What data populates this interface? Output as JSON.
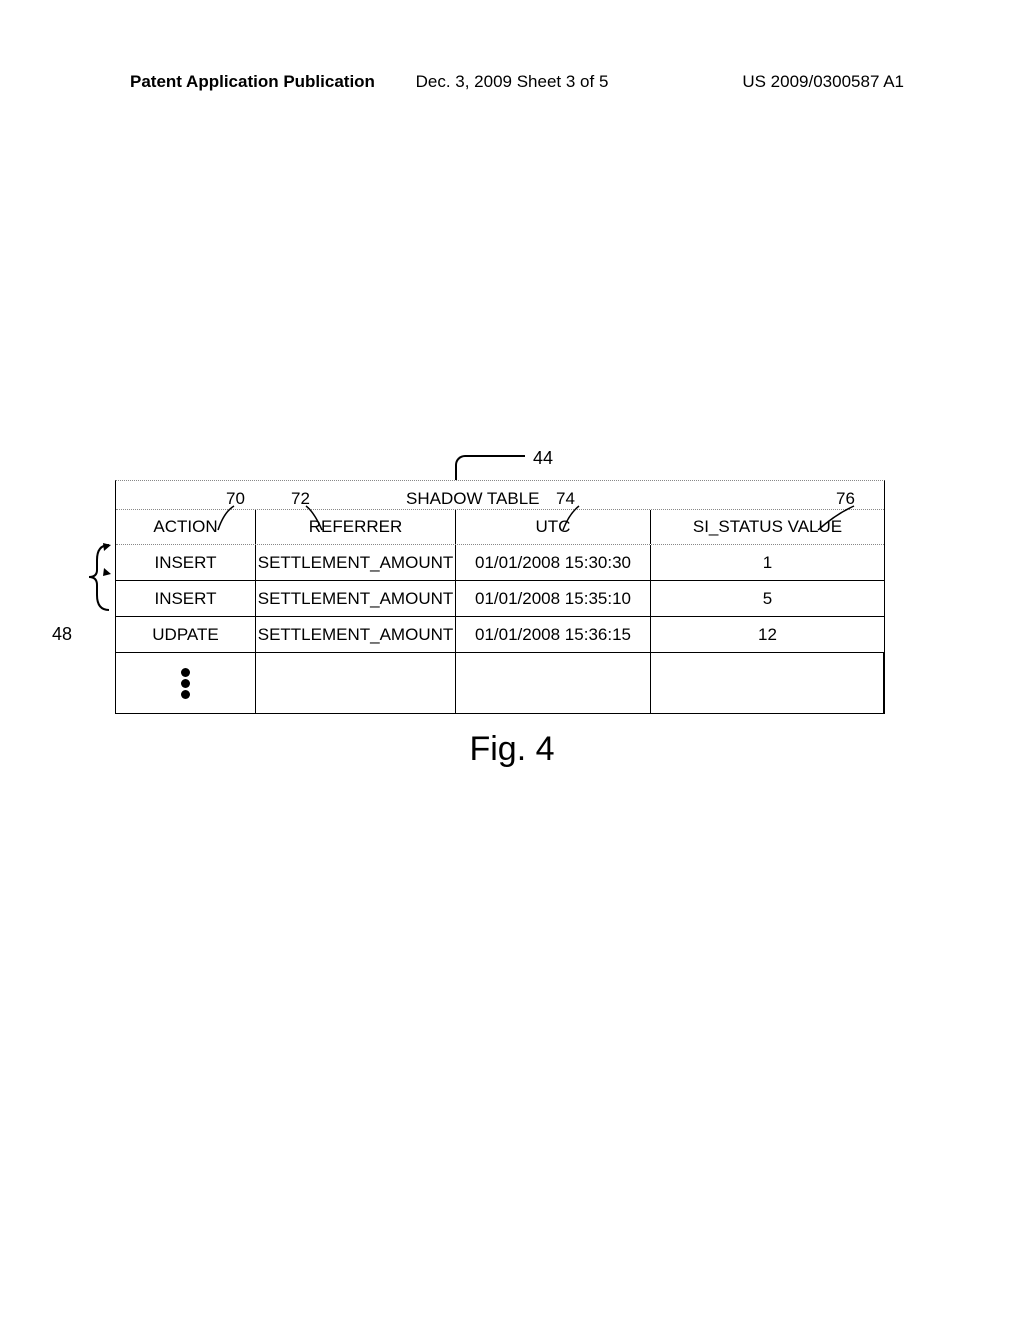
{
  "header": {
    "left": "Patent Application Publication",
    "center": "Dec. 3, 2009   Sheet 3 of 5",
    "right": "US 2009/0300587 A1"
  },
  "refs": {
    "r44": "44",
    "r70": "70",
    "r72": "72",
    "r74": "74",
    "r76": "76",
    "r48": "48"
  },
  "table": {
    "title": "SHADOW TABLE",
    "columns": [
      "ACTION",
      "REFERRER",
      "UTC",
      "SI_STATUS VALUE"
    ],
    "rows": [
      {
        "action": "INSERT",
        "referrer": "SETTLEMENT_AMOUNT",
        "utc": "01/01/2008 15:30:30",
        "status": "1"
      },
      {
        "action": "INSERT",
        "referrer": "SETTLEMENT_AMOUNT",
        "utc": "01/01/2008 15:35:10",
        "status": "5"
      },
      {
        "action": "UDPATE",
        "referrer": "SETTLEMENT_AMOUNT",
        "utc": "01/01/2008 15:36:15",
        "status": "12"
      }
    ]
  },
  "caption": "Fig. 4"
}
